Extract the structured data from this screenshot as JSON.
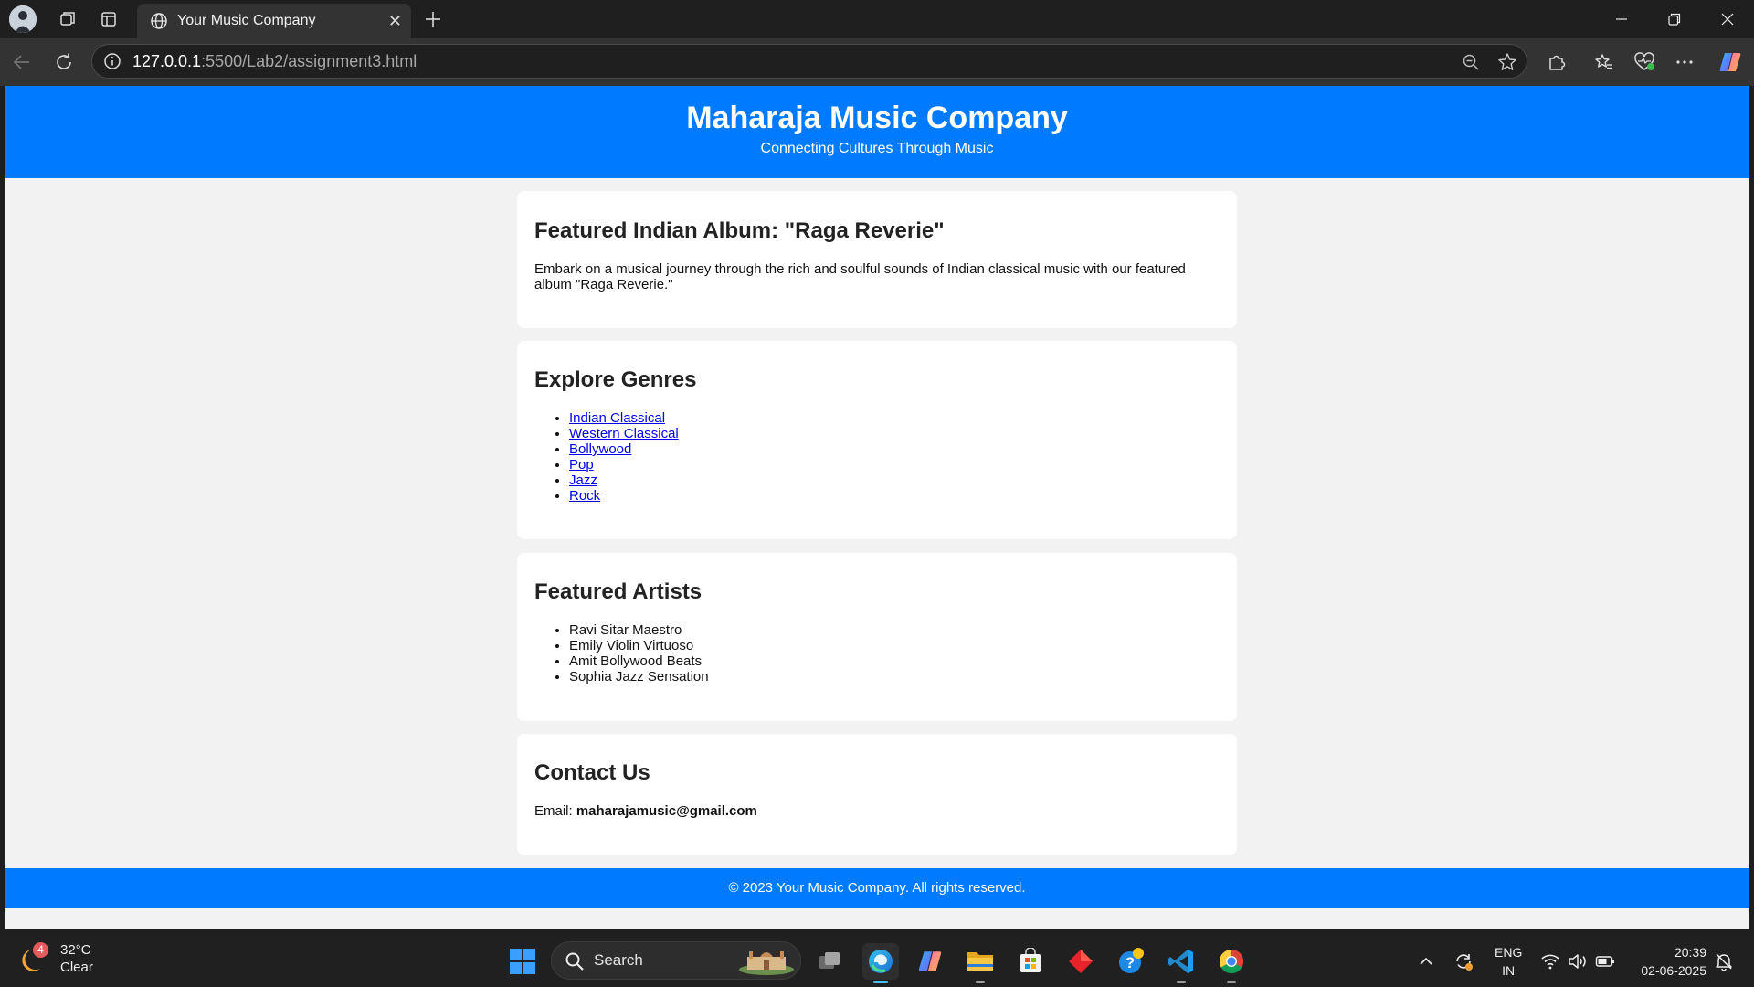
{
  "browser": {
    "tab_title": "Your Music Company",
    "url_host": "127.0.0.1",
    "url_path": ":5500/Lab2/assignment3.html"
  },
  "page": {
    "header": {
      "title": "Maharaja Music Company",
      "tagline": "Connecting Cultures Through Music"
    },
    "featured_album": {
      "heading": "Featured Indian Album: \"Raga Reverie\"",
      "description": "Embark on a musical journey through the rich and soulful sounds of Indian classical music with our featured album \"Raga Reverie.\""
    },
    "genres": {
      "heading": "Explore Genres",
      "items": [
        "Indian Classical",
        "Western Classical",
        "Bollywood",
        "Pop",
        "Jazz",
        "Rock"
      ]
    },
    "artists": {
      "heading": "Featured Artists",
      "items": [
        "Ravi Sitar Maestro",
        "Emily Violin Virtuoso",
        "Amit Bollywood Beats",
        "Sophia Jazz Sensation"
      ]
    },
    "contact": {
      "heading": "Contact Us",
      "email_label": "Email: ",
      "email": "maharajamusic@gmail.com"
    },
    "footer": "© 2023 Your Music Company. All rights reserved."
  },
  "taskbar": {
    "weather_badge": "4",
    "temperature": "32°C",
    "condition": "Clear",
    "search_label": "Search",
    "lang_1": "ENG",
    "lang_2": "IN",
    "time": "20:39",
    "date": "02-06-2025"
  },
  "colors": {
    "header_blue": "#007bff",
    "link": "#0000ee"
  }
}
